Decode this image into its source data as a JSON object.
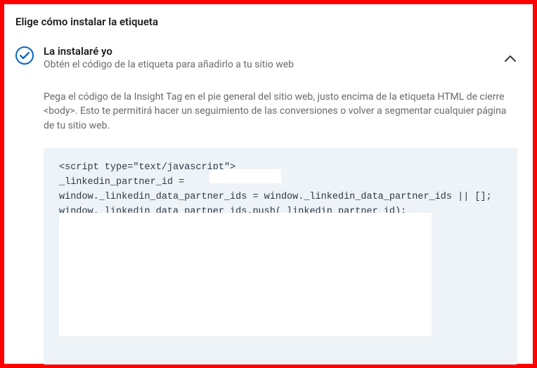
{
  "page": {
    "title": "Elige cómo instalar la etiqueta"
  },
  "option": {
    "title": "La instalaré yo",
    "subtitle": "Obtén el código de la etiqueta para añadirlo a tu sitio web"
  },
  "description": "Pega el código de la Insight Tag en el pie general del sitio web, justo encima de la etiqueta HTML de cierre <body>. Esto te permitirá hacer un seguimiento de las conversiones o volver a segmentar cualquier página de tu sitio web.",
  "code": {
    "line1": "<script type=\"text/javascript\">",
    "line2": "_linkedin_partner_id = ",
    "line3": "window._linkedin_data_partner_ids = window._linkedin_data_partner_ids || [];",
    "line4": "window._linkedin_data_partner_ids.push(_linkedin_partner_id);"
  },
  "icons": {
    "radio": "radio-selected-icon",
    "chevron": "chevron-up-icon"
  }
}
